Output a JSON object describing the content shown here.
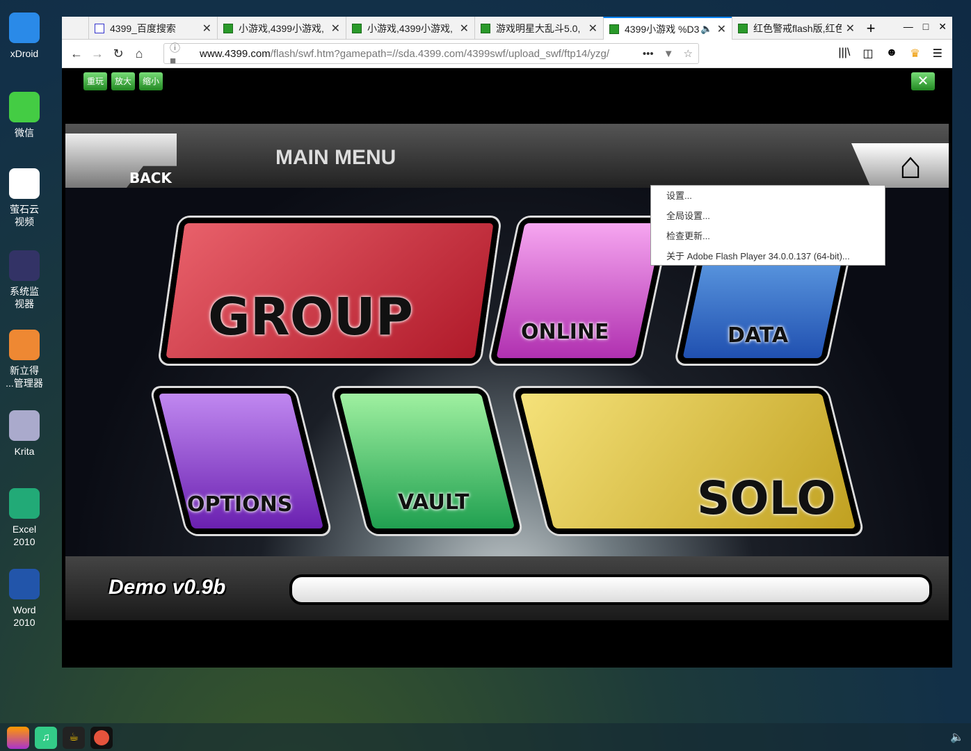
{
  "desktop": {
    "icons": [
      {
        "label": "xDroid"
      },
      {
        "label": "微信"
      },
      {
        "label": "萤石云\n视频"
      },
      {
        "label": "系统监\n视器"
      },
      {
        "label": "新立得\n...管理器"
      },
      {
        "label": "Krita"
      },
      {
        "label": "Excel\n2010"
      },
      {
        "label": "Word\n2010"
      }
    ]
  },
  "browser": {
    "tabs": [
      {
        "label": "4399_百度搜索"
      },
      {
        "label": "小游戏,4399小游戏,"
      },
      {
        "label": "小游戏,4399小游戏,"
      },
      {
        "label": "游戏明星大乱斗5.0,"
      },
      {
        "label": "4399小游戏 %D3"
      },
      {
        "label": "红色警戒flash版,红色"
      }
    ],
    "new_tab": "+",
    "url_domain": "www.4399.com",
    "url_rest": "/flash/swf.htm?gamepath=//sda.4399.com/4399swf/upload_swf/ftp14/yzg/",
    "url_prefix": ""
  },
  "page": {
    "buttons": [
      "重玩",
      "放大",
      "缩小"
    ]
  },
  "game": {
    "title": "MAIN MENU",
    "back": "BACK",
    "tiles": [
      "GROUP",
      "ONLINE",
      "DATA",
      "OPTIONS",
      "VAULT",
      "SOLO"
    ],
    "version": "Demo v0.9b"
  },
  "context_menu": [
    "设置...",
    "全局设置...",
    "检查更新...",
    "关于 Adobe Flash Player 34.0.0.137 (64-bit)..."
  ]
}
